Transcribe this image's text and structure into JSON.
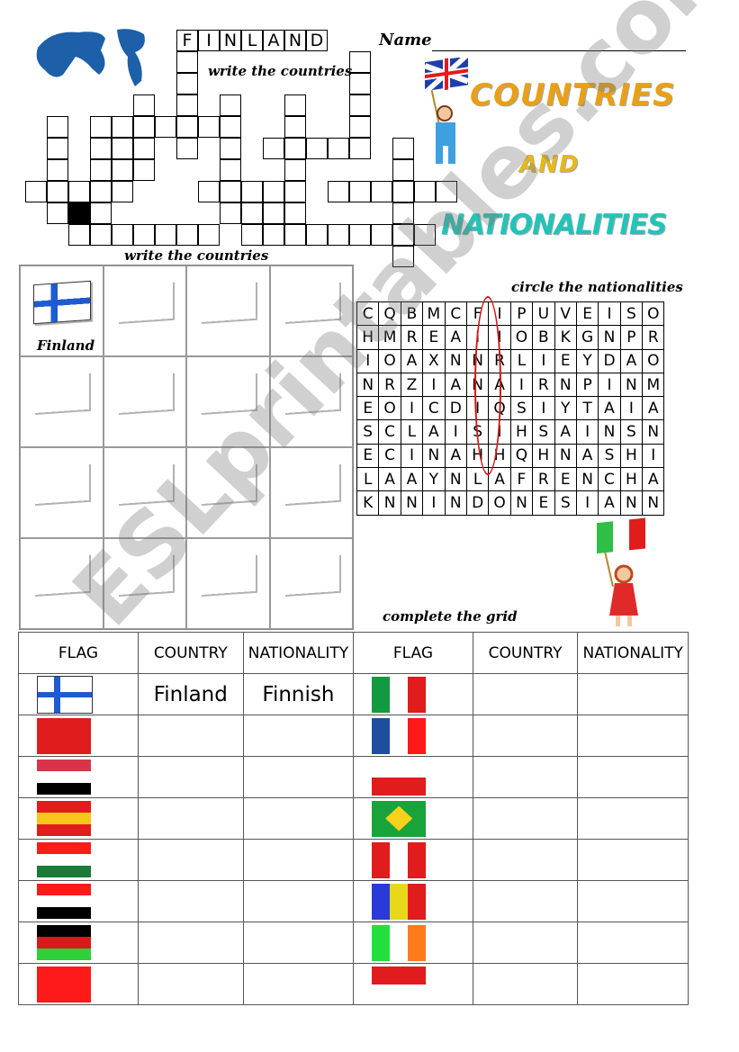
{
  "header": {
    "name_label": "Name",
    "title_line1": "COUNTRIES",
    "title_line2": "AND",
    "title_line3": "NATIONALITIES"
  },
  "crossword": {
    "instruction": "write the countries",
    "given_word": [
      "F",
      "I",
      "N",
      "L",
      "A",
      "N",
      "D"
    ]
  },
  "maps": {
    "instruction": "write the countries",
    "example_label": "Finland",
    "cells": [
      {
        "flag": [
          "#ffffff",
          "#1e5bd0"
        ],
        "style": "nordic"
      },
      {
        "flag": [
          "#d82020",
          "#ffffff",
          "#000000"
        ],
        "style": "h"
      },
      {
        "flag": [
          "#139a40",
          "#ffffff",
          "#e11c1c"
        ],
        "style": "v"
      },
      {
        "flag": [
          "#e11c1c",
          "#ffffff"
        ],
        "style": "h"
      },
      {
        "flag": [
          "#e11c1c",
          "#f7d21b",
          "#e11c1c"
        ],
        "style": "h"
      },
      {
        "flag": [
          "#3b4fd8",
          "#ffffff",
          "#e11c1c"
        ],
        "style": "v"
      },
      {
        "flag": [
          "#ff8a1a",
          "#ffffff",
          "#2fbf46"
        ],
        "style": "h"
      },
      {
        "flag": [
          "#34c23a",
          "#ffffff",
          "#e11c1c"
        ],
        "style": "h"
      },
      {
        "flag": [
          "#e11c1c",
          "#ffffff",
          "#000000"
        ],
        "style": "h"
      },
      {
        "flag": [
          "#26b22e",
          "#f7d21b",
          "#26b22e"
        ],
        "style": "v"
      },
      {
        "flag": [
          "#e11c1c",
          "#ffffff",
          "#e11c1c"
        ],
        "style": "v"
      },
      {
        "flag": [
          "#000000",
          "#e11c1c",
          "#2fa034"
        ],
        "style": "h"
      },
      {
        "flag": [
          "#e11c1c",
          "#e11c1c"
        ],
        "style": "h"
      },
      {
        "flag": [
          "#1f3fc0",
          "#f7d21b",
          "#e11c1c"
        ],
        "style": "v"
      },
      {
        "flag": [
          "#e11c1c",
          "#e11c1c"
        ],
        "style": "h"
      },
      {
        "flag": [
          "#2fbf46",
          "#ffffff",
          "#e11c1c"
        ],
        "style": "v"
      }
    ]
  },
  "wordsearch": {
    "instruction": "circle the nationalities",
    "rows": [
      "CQBMCFIPUVEISO",
      "HMREAIIOBKGNPR",
      "IOAXNNRLIEYDAO",
      "NRZIANAIRNPINM",
      "EOICDIQSIYTAIA",
      "SCLAISIHSAINSN",
      "ECINAHHQHNASHI",
      "LAAYNLAFRENCHA",
      "KNNINDONESIANN"
    ],
    "circle_color": "#d01818"
  },
  "grid": {
    "instruction": "complete the grid",
    "headers": [
      "FLAG",
      "COUNTRY",
      "NATIONALITY",
      "FLAG",
      "COUNTRY",
      "NATIONALITY"
    ],
    "rows": [
      {
        "left_flag": {
          "colors": [
            "#ffffff",
            "#1e5bd0"
          ],
          "style": "nordic"
        },
        "left_country": "Finland",
        "left_nationality": "Finnish",
        "right_flag": {
          "colors": [
            "#139a40",
            "#ffffff",
            "#e11c1c"
          ],
          "style": "v"
        },
        "right_country": "",
        "right_nationality": ""
      },
      {
        "left_flag": {
          "colors": [
            "#e11c1c",
            "#e11c1c"
          ],
          "style": "h"
        },
        "left_country": "",
        "left_nationality": "",
        "right_flag": {
          "colors": [
            "#1f4ea0",
            "#ffffff",
            "#ff1a1a"
          ],
          "style": "v"
        },
        "right_country": "",
        "right_nationality": ""
      },
      {
        "left_flag": {
          "colors": [
            "#d8354a",
            "#ffffff",
            "#000000"
          ],
          "style": "h"
        },
        "left_country": "",
        "left_nationality": "",
        "right_flag": {
          "colors": [
            "#ffffff",
            "#e11c1c"
          ],
          "style": "h"
        },
        "right_country": "",
        "right_nationality": ""
      },
      {
        "left_flag": {
          "colors": [
            "#e11c1c",
            "#f7c51b",
            "#e11c1c"
          ],
          "style": "h"
        },
        "left_country": "",
        "left_nationality": "",
        "right_flag": {
          "colors": [
            "#1aa33a",
            "#f7d21b",
            "#1aa33a"
          ],
          "style": "brazil"
        },
        "right_country": "",
        "right_nationality": ""
      },
      {
        "left_flag": {
          "colors": [
            "#ff1a1a",
            "#ffffff",
            "#1a7a3a"
          ],
          "style": "h"
        },
        "left_country": "",
        "left_nationality": "",
        "right_flag": {
          "colors": [
            "#e11c1c",
            "#ffffff",
            "#e11c1c"
          ],
          "style": "v"
        },
        "right_country": "",
        "right_nationality": ""
      },
      {
        "left_flag": {
          "colors": [
            "#ff1a1a",
            "#ffffff",
            "#000000"
          ],
          "style": "h"
        },
        "left_country": "",
        "left_nationality": "",
        "right_flag": {
          "colors": [
            "#2a3ad8",
            "#e8d81a",
            "#e11c1c"
          ],
          "style": "v"
        },
        "right_country": "",
        "right_nationality": ""
      },
      {
        "left_flag": {
          "colors": [
            "#000000",
            "#d81a1a",
            "#2fd03a"
          ],
          "style": "h"
        },
        "left_country": "",
        "left_nationality": "",
        "right_flag": {
          "colors": [
            "#22e03a",
            "#ffffff",
            "#ff7a1a"
          ],
          "style": "v"
        },
        "right_country": "",
        "right_nationality": ""
      },
      {
        "left_flag": {
          "colors": [
            "#ff1a1a",
            "#ff1a1a"
          ],
          "style": "h"
        },
        "left_country": "",
        "left_nationality": "",
        "right_flag": {
          "colors": [
            "#e11c1c",
            "#ffffff"
          ],
          "style": "h"
        },
        "right_country": "",
        "right_nationality": ""
      }
    ]
  },
  "watermark": "ESLprintables.com"
}
